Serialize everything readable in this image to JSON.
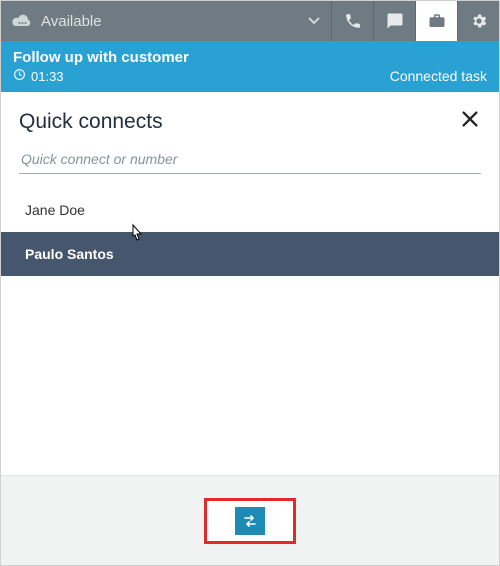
{
  "topbar": {
    "status_label": "Available"
  },
  "task": {
    "title": "Follow up with customer",
    "elapsed": "01:33",
    "status": "Connected task"
  },
  "panel": {
    "title": "Quick connects",
    "search_placeholder": "Quick connect or number"
  },
  "quick_connects": [
    {
      "name": "Jane Doe",
      "selected": false
    },
    {
      "name": "Paulo Santos",
      "selected": true
    }
  ]
}
